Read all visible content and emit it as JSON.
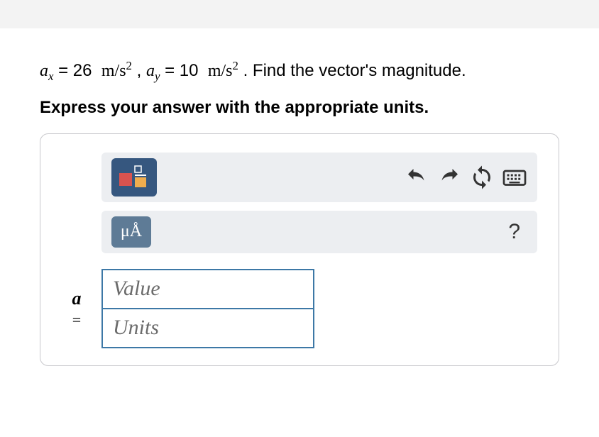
{
  "problem": {
    "ax_var": "a",
    "ax_sub": "x",
    "ax_val": "= 26",
    "ay_var": "a",
    "ay_sub": "y",
    "ay_val": "= 10",
    "unit_m": "m",
    "unit_slash": "/",
    "unit_s": "s",
    "unit_exp": "2",
    "comma": " , ",
    "period": " . ",
    "tail": "Find the vector's magnitude."
  },
  "instruction": "Express your answer with the appropriate units.",
  "toolbar": {
    "units_label": "μÅ",
    "help_label": "?"
  },
  "answer": {
    "var_label": "a",
    "equals": "=",
    "value_placeholder": "Value",
    "units_placeholder": "Units"
  }
}
